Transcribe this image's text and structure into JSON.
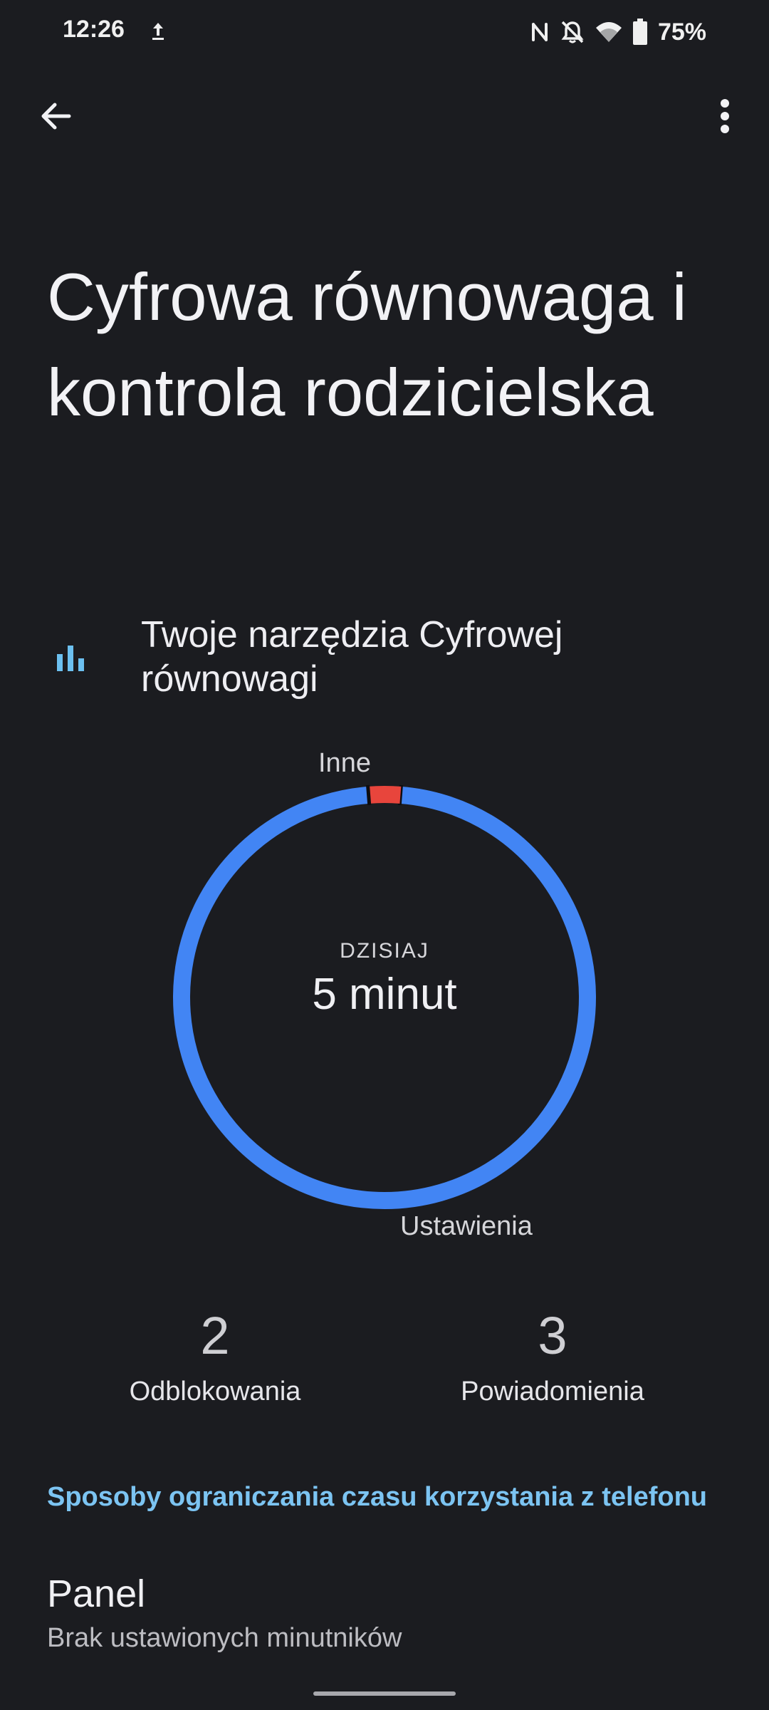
{
  "status_bar": {
    "time": "12:26",
    "battery": "75%",
    "icons": [
      "upload-icon",
      "nfc-icon",
      "bell-off-icon",
      "wifi-icon",
      "battery-icon"
    ]
  },
  "toolbar": {
    "back_icon": "arrow-back-icon",
    "more_icon": "more-vert-icon"
  },
  "page": {
    "title": "Cyfrowa równowaga i kontrola rodzicielska"
  },
  "tools": {
    "icon": "bar-chart-icon",
    "label": "Twoje narzędzia Cyfrowej równowagi"
  },
  "chart_data": {
    "type": "pie",
    "center_caption": "DZISIAJ",
    "center_value": "5 minut",
    "slices": [
      {
        "label": "Ustawienia",
        "fraction": 0.975,
        "color": "#4285f4"
      },
      {
        "label": "Inne",
        "fraction": 0.025,
        "color": "#e8453c"
      }
    ]
  },
  "stats": [
    {
      "value": "2",
      "label": "Odblokowania"
    },
    {
      "value": "3",
      "label": "Powiadomienia"
    }
  ],
  "section": {
    "link": "Sposoby ograniczania czasu korzystania z telefonu"
  },
  "panel": {
    "title": "Panel",
    "subtitle": "Brak ustawionych minutników"
  },
  "colors": {
    "background": "#1b1c20",
    "accent": "#7cc4f2",
    "chart_primary": "#4285f4",
    "chart_secondary": "#e8453c"
  }
}
